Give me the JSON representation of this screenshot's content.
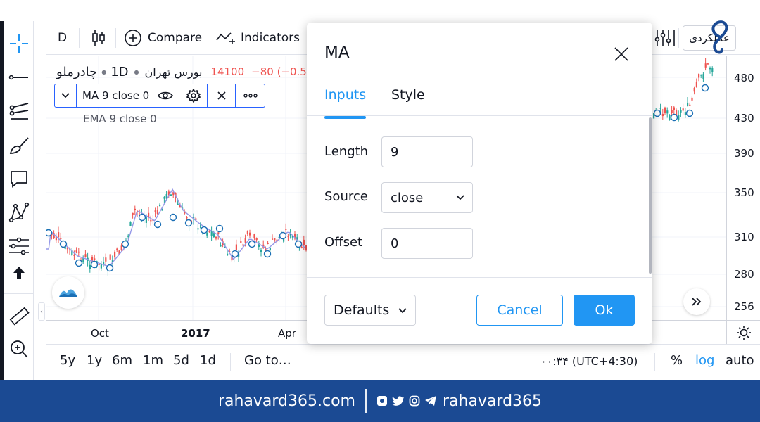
{
  "toolbar": {
    "interval": "D",
    "compare_label": "Compare",
    "indicators_label": "Indicators",
    "right_button_label": "عملکردی"
  },
  "legend": {
    "symbol": "چادرملو",
    "interval": "1D",
    "exchange": "بورس تهران",
    "price": "14100",
    "change": "−80 (−0.5",
    "study_label": "MA 9 close 0",
    "ema_label": "EMA 9 close 0"
  },
  "price_axis": {
    "ticks": [
      "480",
      "430",
      "390",
      "350",
      "310",
      "280",
      "256"
    ]
  },
  "time_axis": {
    "ticks": [
      "Oct",
      "2017",
      "Apr"
    ]
  },
  "bottom_bar": {
    "ranges": [
      "5y",
      "1y",
      "6m",
      "1m",
      "5d",
      "1d"
    ],
    "goto_label": "Go to…",
    "clock": "۰۰:۳۴ (UTC+4:30)",
    "percent_label": "%",
    "log_label": "log",
    "auto_label": "auto"
  },
  "dialog": {
    "title": "MA",
    "tabs": [
      "Inputs",
      "Style"
    ],
    "active_tab": "Inputs",
    "fields": {
      "length_label": "Length",
      "length_value": "9",
      "source_label": "Source",
      "source_value": "close",
      "offset_label": "Offset",
      "offset_value": "0"
    },
    "defaults_label": "Defaults",
    "cancel_label": "Cancel",
    "ok_label": "Ok"
  },
  "footer": {
    "site": "rahavard365.com",
    "handle": "rahavard365"
  },
  "colors": {
    "accent": "#2196f3",
    "up": "#26a69a",
    "down": "#ef5350",
    "ma_line": "#9598e8",
    "footer_bg": "#1b4a93",
    "legend_price_red": "#ef5350"
  }
}
